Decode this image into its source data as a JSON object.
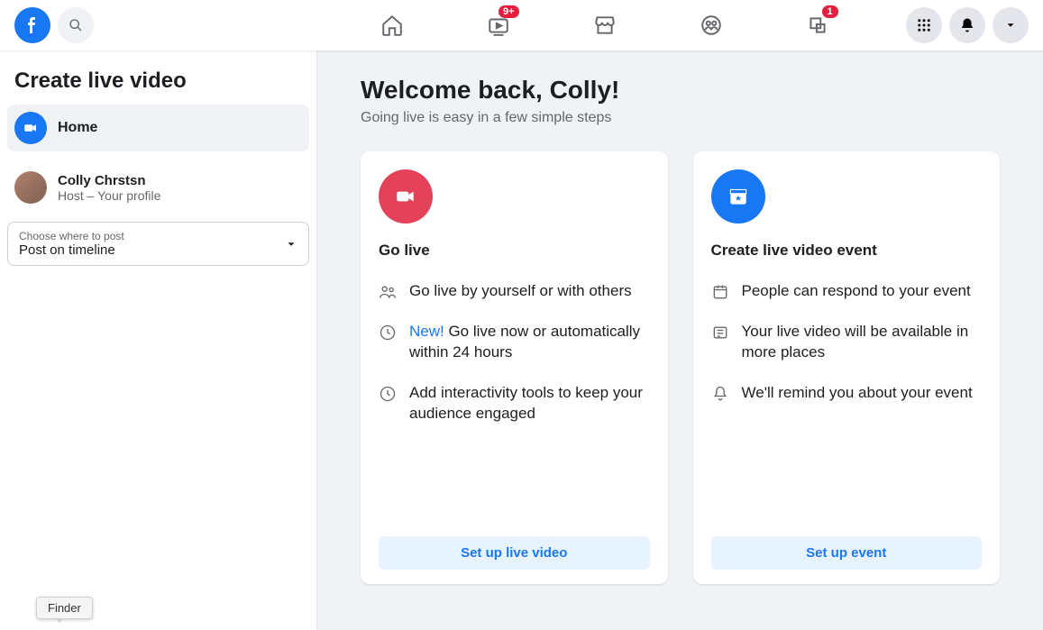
{
  "header": {
    "badges": {
      "watch": "9+",
      "gaming": "1"
    }
  },
  "sidebar": {
    "title": "Create live video",
    "home_label": "Home",
    "user_name": "Colly Chrstsn",
    "user_subtitle": "Host – Your profile",
    "post_select": {
      "label": "Choose where to post",
      "value": "Post on timeline"
    }
  },
  "main": {
    "welcome_title": "Welcome back, Colly!",
    "welcome_subtitle": "Going live is easy in a few simple steps",
    "card_live": {
      "title": "Go live",
      "feat1": "Go live by yourself or with others",
      "feat2_new": "New!",
      "feat2_rest": " Go live now or automatically within 24 hours",
      "feat3": "Add interactivity tools to keep your audience engaged",
      "button": "Set up live video"
    },
    "card_event": {
      "title": "Create live video event",
      "feat1": "People can respond to your event",
      "feat2": "Your live video will be available in more places",
      "feat3": "We'll remind you about your event",
      "button": "Set up event"
    }
  },
  "tooltip": "Finder"
}
